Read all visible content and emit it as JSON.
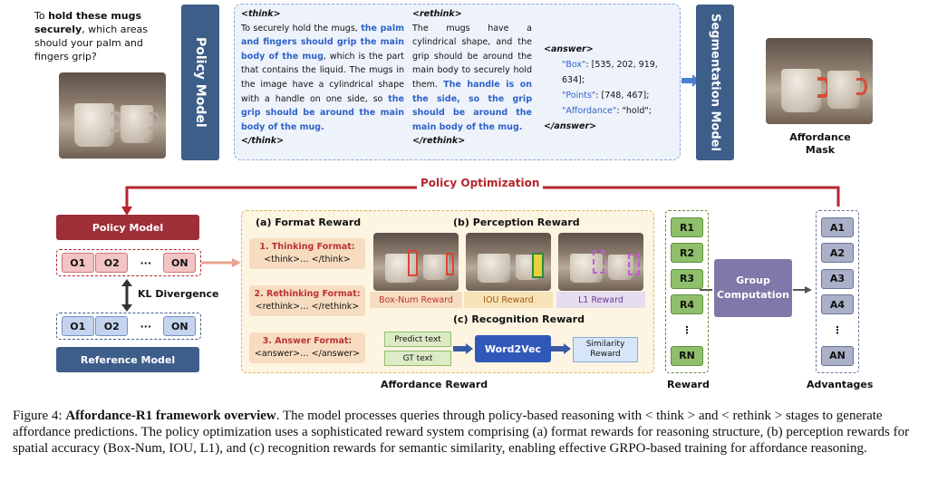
{
  "query": {
    "pre": "To ",
    "bold": "hold these mugs securely",
    "post": ", which areas should your palm and fingers grip?"
  },
  "policy_model_top": "Policy Model",
  "think": {
    "open": "<think>",
    "p1": "To securely hold the mugs, ",
    "b1": "the palm and fingers should grip the main body of the mug",
    "p2": ", which is the part that contains the liquid. The mugs in the image have a cylindrical shape with a handle on one side, so ",
    "b2": "the grip should be around the main body of the mug.",
    "close": "</think>"
  },
  "rethink": {
    "open": "<rethink>",
    "p1": "The mugs have a cylindrical shape, and the grip should be around the main body to securely hold them. ",
    "b1": "The handle is on the side, so the grip should be around the main body of the mug.",
    "close": "</rethink>"
  },
  "answer": {
    "open": "<answer>",
    "box_key": "\"Box\"",
    "box_val": ": [535, 202, 919, 634];",
    "points_key": "\"Points\"",
    "points_val": ": [748, 467];",
    "aff_key": "\"Affordance\"",
    "aff_val": ": \"hold\";",
    "close": "</answer>"
  },
  "seg_model": "Segmentation Model",
  "affordance_mask": "Affordance Mask",
  "policy_optimization": "Policy Optimization",
  "policy_model_bottom": "Policy Model",
  "kl": "KL Divergence",
  "reference_model": "Reference Model",
  "outputs": [
    "O1",
    "O2",
    "···",
    "ON"
  ],
  "format_reward": {
    "title": "(a) Format Reward",
    "items": [
      {
        "label": "1. Thinking Format:",
        "tag": "<think>… </think>"
      },
      {
        "label": "2. Rethinking Format:",
        "tag": "<rethink>… </rethink>"
      },
      {
        "label": "3. Answer Format:",
        "tag": "<answer>… </answer>"
      }
    ]
  },
  "perception_reward": {
    "title": "(b) Perception Reward",
    "labels": [
      "Box-Num Reward",
      "IOU Reward",
      "L1 Reward"
    ]
  },
  "recognition_reward": {
    "title": "(c) Recognition Reward",
    "predict": "Predict text",
    "gt": "GT text",
    "word2vec": "Word2Vec",
    "similarity": "Similarity Reward"
  },
  "affordance_reward": "Affordance Reward",
  "rewards": [
    "R1",
    "R2",
    "R3",
    "R4",
    "⋮",
    "RN"
  ],
  "reward_label": "Reward",
  "group_computation": "Group Computation",
  "advantages": [
    "A1",
    "A2",
    "A3",
    "A4",
    "⋮",
    "AN"
  ],
  "advantages_label": "Advantages",
  "caption": {
    "prefix": "Figure 4: ",
    "bold": "Affordance-R1 framework overview",
    "text": ". The model processes queries through policy-based reasoning with < think > and < rethink > stages to generate affordance predictions. The policy optimization uses a sophisticated reward system comprising (a) format rewards for reasoning structure, (b) perception rewards for spatial accuracy (Box-Num, IOU, L1), and (c) recognition rewards for semantic similarity, enabling effective GRPO-based training for affordance reasoning."
  },
  "colors": {
    "policy_blue": "#3e5e8a",
    "policy_red": "#9e2f38",
    "arrow_red": "#b5262d",
    "green": "#8fbf6a",
    "purple": "#7f78a8",
    "cream": "#fdf5e2",
    "highlight_blue": "#2f62c9"
  }
}
